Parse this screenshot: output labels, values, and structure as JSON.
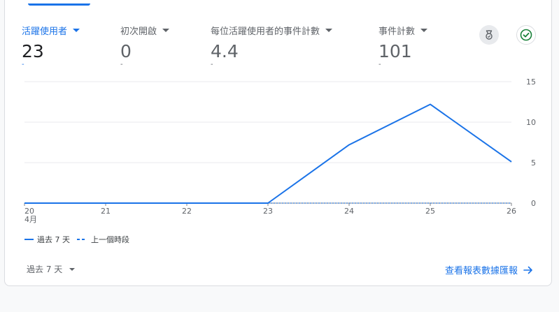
{
  "metrics": [
    {
      "label": "活躍使用者",
      "value": "23",
      "sub": "-"
    },
    {
      "label": "初次開啟",
      "value": "0",
      "sub": "-"
    },
    {
      "label": "每位活躍使用者的事件計數",
      "value": "4.4",
      "sub": "-"
    },
    {
      "label": "事件計數",
      "value": "101",
      "sub": "-"
    }
  ],
  "icons": {
    "insight": "insights-badge-icon",
    "check": "check-circle-icon"
  },
  "colors": {
    "accent": "#1a73e8",
    "check_green": "#188038"
  },
  "chart_data": {
    "type": "line",
    "x": [
      "20",
      "21",
      "22",
      "23",
      "24",
      "25",
      "26"
    ],
    "x_month_label": "4月",
    "ylim": [
      0,
      15
    ],
    "y_ticks": [
      "0",
      "5",
      "10",
      "15"
    ],
    "series": [
      {
        "name": "過去 7 天",
        "values": [
          0,
          0,
          0,
          0,
          7.2,
          12.2,
          5.1
        ],
        "style": "solid"
      },
      {
        "name": "上一個時段",
        "values": [
          0,
          0,
          0,
          0,
          0,
          0,
          0
        ],
        "style": "dashed"
      }
    ],
    "grid": true,
    "legend_position": "bottom-left"
  },
  "footer": {
    "period_label": "過去 7 天",
    "report_link": "查看報表數據匯報"
  }
}
